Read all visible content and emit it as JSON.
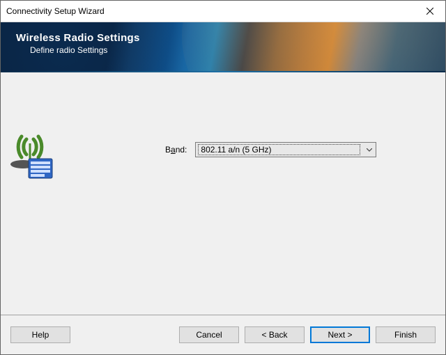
{
  "window": {
    "title": "Connectivity Setup Wizard"
  },
  "banner": {
    "heading": "Wireless Radio Settings",
    "subheading": "Define radio Settings"
  },
  "form": {
    "band_label_pre": "B",
    "band_label_accel": "a",
    "band_label_post": "nd:",
    "band_value": "802.11 a/n (5 GHz)"
  },
  "buttons": {
    "help": "Help",
    "cancel": "Cancel",
    "back": "< Back",
    "next": "Next >",
    "finish": "Finish"
  }
}
